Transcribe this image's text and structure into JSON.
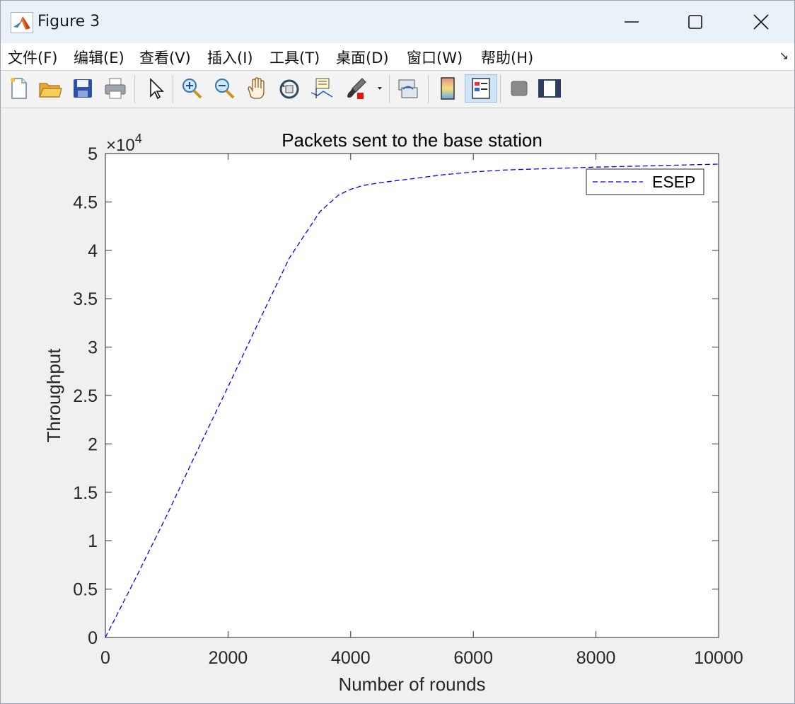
{
  "window": {
    "title": "Figure 3",
    "controls": {
      "minimize": "minimize-icon",
      "maximize": "maximize-icon",
      "close": "close-icon"
    }
  },
  "menu": {
    "items": [
      "文件(F)",
      "编辑(E)",
      "查看(V)",
      "插入(I)",
      "工具(T)",
      "桌面(D)",
      "窗口(W)",
      "帮助(H)"
    ],
    "overflow_icon": "dock-arrow-icon"
  },
  "toolbar": {
    "tools": [
      "new-figure-icon",
      "open-folder-icon",
      "save-icon",
      "print-icon",
      "pointer-icon",
      "zoom-in-icon",
      "zoom-out-icon",
      "pan-hand-icon",
      "rotate-3d-icon",
      "data-cursor-icon",
      "brush-icon",
      "link-plot-icon",
      "colorbar-icon",
      "legend-icon",
      "hide-plot-tools-icon",
      "show-plot-tools-icon"
    ],
    "active_tool": "legend-icon"
  },
  "chart_data": {
    "type": "line",
    "title": "Packets sent to the base station",
    "xlabel": "Number of rounds",
    "ylabel": "Throughput",
    "xlim": [
      0,
      10000
    ],
    "ylim": [
      0,
      50000
    ],
    "xticks": [
      "0",
      "2000",
      "4000",
      "6000",
      "8000",
      "10000"
    ],
    "yticks": [
      "0",
      "0.5",
      "1",
      "1.5",
      "2",
      "2.5",
      "3",
      "3.5",
      "4",
      "4.5",
      "5"
    ],
    "y_exponent": "4",
    "y_multiplier_prefix": "×10",
    "legend_position": "top-right",
    "grid": false,
    "series": [
      {
        "name": "ESEP",
        "color": "#0000ff",
        "style": "dashed",
        "x": [
          0,
          500,
          1000,
          1500,
          2000,
          2500,
          3000,
          3500,
          3800,
          4000,
          4200,
          4500,
          5000,
          5500,
          6000,
          6500,
          7000,
          8000,
          9000,
          10000
        ],
        "y": [
          0,
          6200,
          12600,
          19300,
          25900,
          32600,
          39200,
          44000,
          45700,
          46300,
          46700,
          47000,
          47400,
          47800,
          48100,
          48300,
          48400,
          48600,
          48750,
          48900
        ]
      }
    ]
  }
}
